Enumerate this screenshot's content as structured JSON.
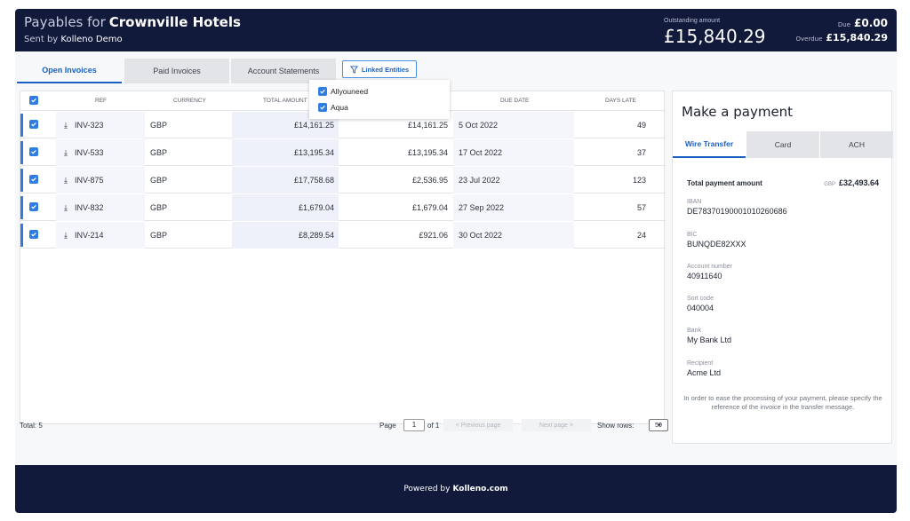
{
  "header": {
    "title_prefix": "Payables for",
    "company": "Crownville Hotels",
    "sent_by_label": "Sent by",
    "sent_by": "Kolleno Demo",
    "outstanding_label": "Outstanding amount",
    "outstanding_value": "£15,840.29",
    "due_label": "Due",
    "due_value": "£0.00",
    "overdue_label": "Overdue",
    "overdue_value": "£15,840.29"
  },
  "tabs": [
    "Open Invoices",
    "Paid Invoices",
    "Account Statements"
  ],
  "linked_entities_label": "Linked Entities",
  "linked_entities": [
    "Allyouneed",
    "Aqua"
  ],
  "table": {
    "columns": [
      "REF",
      "CURRENCY",
      "TOTAL AMOUNT",
      "DUE DATE",
      "DAYS LATE"
    ],
    "rows": [
      {
        "ref": "INV-323",
        "currency": "GBP",
        "total": "£14,161.25",
        "outstanding": "£14,161.25",
        "due": "5 Oct 2022",
        "days": "49"
      },
      {
        "ref": "INV-533",
        "currency": "GBP",
        "total": "£13,195.34",
        "outstanding": "£13,195.34",
        "due": "17 Oct 2022",
        "days": "37"
      },
      {
        "ref": "INV-875",
        "currency": "GBP",
        "total": "£17,758.68",
        "outstanding": "£2,536.95",
        "due": "23 Jul 2022",
        "days": "123"
      },
      {
        "ref": "INV-832",
        "currency": "GBP",
        "total": "£1,679.04",
        "outstanding": "£1,679.04",
        "due": "27 Sep 2022",
        "days": "57"
      },
      {
        "ref": "INV-214",
        "currency": "GBP",
        "total": "£8,289.54",
        "outstanding": "£921.06",
        "due": "30 Oct 2022",
        "days": "24"
      }
    ]
  },
  "footer": {
    "total": "Total: 5",
    "page_label": "Page",
    "page_value": "1",
    "of_label": "of 1",
    "prev": "< Previous page",
    "next": "Next page >",
    "show_rows": "Show rows:",
    "rows_value": "50"
  },
  "payment": {
    "title": "Make a payment",
    "tabs": [
      "Wire Transfer",
      "Card",
      "ACH"
    ],
    "total_label": "Total payment amount",
    "total_currency": "GBP",
    "total_value": "£32,493.64",
    "fields": [
      {
        "label": "IBAN",
        "value": "DE78370190001010260686"
      },
      {
        "label": "BIC",
        "value": "BUNQDE82XXX"
      },
      {
        "label": "Account number",
        "value": "40911640"
      },
      {
        "label": "Sort code",
        "value": "040004"
      },
      {
        "label": "Bank",
        "value": "My Bank Ltd"
      },
      {
        "label": "Recipient",
        "value": "Acme Ltd"
      }
    ],
    "note": "In order to ease the processing of your payment, please specify the reference of the invoice in the transfer message."
  },
  "powered_by": "Powered by",
  "powered_brand": "Kolleno.com",
  "colors": {
    "navy": "#111a3a",
    "accent": "#2f7de1"
  }
}
